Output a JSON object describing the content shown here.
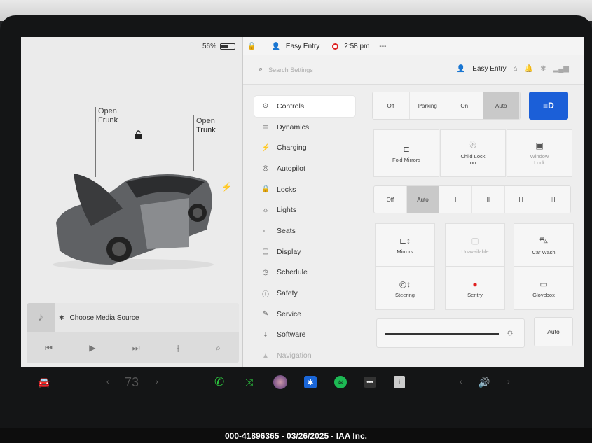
{
  "status": {
    "battery": "56%",
    "profile": "Easy Entry",
    "time": "2:58 pm",
    "extra": "---"
  },
  "left": {
    "frunk": {
      "line1": "Open",
      "line2": "Frunk"
    },
    "trunk": {
      "line1": "Open",
      "line2": "Trunk"
    }
  },
  "media": {
    "source": "Choose Media Source"
  },
  "search": {
    "placeholder": "Search Settings",
    "profile": "Easy Entry"
  },
  "menu": [
    {
      "label": "Controls",
      "icon": "toggle-icon",
      "glyph": "⊙"
    },
    {
      "label": "Dynamics",
      "icon": "car-icon",
      "glyph": "▭"
    },
    {
      "label": "Charging",
      "icon": "bolt-icon",
      "glyph": "⚡"
    },
    {
      "label": "Autopilot",
      "icon": "steering-icon",
      "glyph": "◎"
    },
    {
      "label": "Locks",
      "icon": "lock-icon",
      "glyph": "🔒"
    },
    {
      "label": "Lights",
      "icon": "sun-icon",
      "glyph": "☼"
    },
    {
      "label": "Seats",
      "icon": "seat-icon",
      "glyph": "⌐"
    },
    {
      "label": "Display",
      "icon": "display-icon",
      "glyph": "▢"
    },
    {
      "label": "Schedule",
      "icon": "clock-icon",
      "glyph": "◷"
    },
    {
      "label": "Safety",
      "icon": "alert-icon",
      "glyph": "ⓘ"
    },
    {
      "label": "Service",
      "icon": "wrench-icon",
      "glyph": "✎"
    },
    {
      "label": "Software",
      "icon": "download-icon",
      "glyph": "⤓"
    },
    {
      "label": "Navigation",
      "icon": "nav-icon",
      "glyph": "▲"
    }
  ],
  "headlights": {
    "options": [
      "Off",
      "Parking",
      "On",
      "Auto"
    ],
    "selected": "Auto"
  },
  "tiles_row1": [
    {
      "label": "Fold Mirrors",
      "icon": "mirror-icon"
    },
    {
      "label": "Child Lock On",
      "line1": "Child Lock",
      "line2": "on",
      "icon": "child-lock-icon"
    },
    {
      "label": "Window Lock",
      "line1": "Window",
      "line2": "Lock",
      "icon": "window-lock-icon"
    }
  ],
  "wipers": {
    "options": [
      "Off",
      "Auto",
      "I",
      "II",
      "III",
      "IIII"
    ],
    "selected": "Auto"
  },
  "tiles_grid": [
    {
      "label": "Mirrors",
      "icon": "mirror-adjust-icon"
    },
    {
      "label": "Unavailable",
      "icon": "unavailable-icon"
    },
    {
      "label": "Car Wash",
      "icon": "car-wash-icon"
    },
    {
      "label": "Steering",
      "icon": "steering-adjust-icon"
    },
    {
      "label": "Sentry",
      "icon": "sentry-icon"
    },
    {
      "label": "Glovebox",
      "icon": "glovebox-icon"
    }
  ],
  "brightness": {
    "auto_label": "Auto",
    "level": 0.85
  },
  "dock": {
    "temperature": "73"
  },
  "footer": {
    "caption": "000-41896365 - 03/26/2025 - IAA Inc."
  },
  "colors": {
    "accent": "#1b5fd8",
    "sentry": "#e02020",
    "spotify": "#1db954",
    "phone": "#2ecc40"
  }
}
